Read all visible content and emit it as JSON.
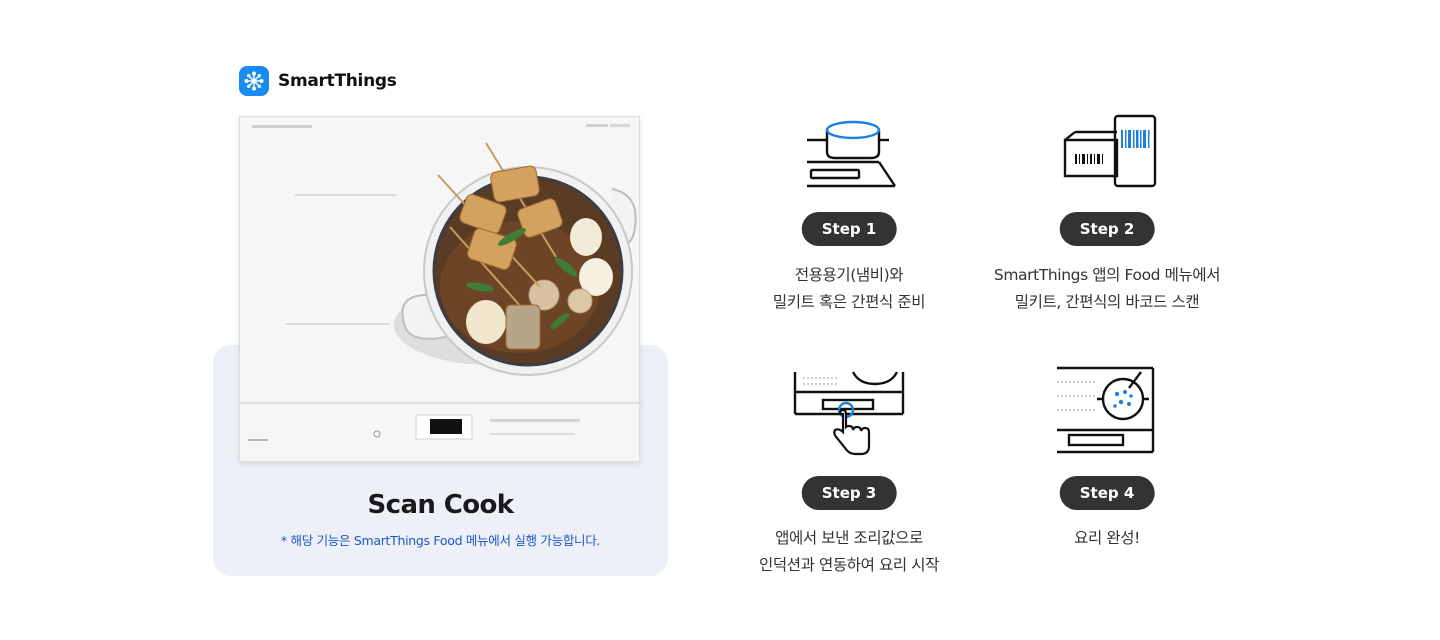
{
  "brand": {
    "name": "SmartThings",
    "icon": "smartthings-logo-icon",
    "color": "#1a8cf0"
  },
  "product": {
    "title": "Scan Cook",
    "note": "* 해당 기능은 SmartThings Food 메뉴에서 실행 가능합니다.",
    "note_color": "#1d58c8",
    "panel_color": "#edf0f6",
    "image": "induction-cooktop-with-fishcake-pot"
  },
  "steps": [
    {
      "label": "Step 1",
      "icon": "pot-on-cooktop-icon",
      "lines": [
        "전용용기(냄비)와",
        "밀키트 혹은 간편식 준비"
      ]
    },
    {
      "label": "Step 2",
      "icon": "phone-barcode-scan-icon",
      "lines": [
        "SmartThings 앱의 Food 메뉴에서",
        "밀키트, 간편식의 바코드 스캔"
      ]
    },
    {
      "label": "Step 3",
      "icon": "touch-cooktop-panel-icon",
      "lines": [
        "앱에서 보낸 조리값으로",
        "인덕션과 연동하여 요리 시작"
      ]
    },
    {
      "label": "Step 4",
      "icon": "cooking-complete-icon",
      "lines": [
        "요리 완성!"
      ]
    }
  ],
  "badge_color": "#333333"
}
